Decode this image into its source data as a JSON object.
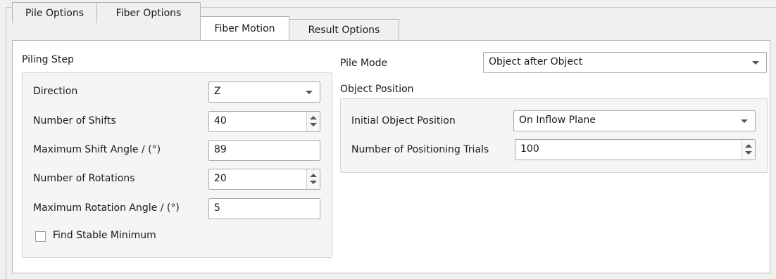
{
  "tabs": [
    {
      "label": "Pile Options"
    },
    {
      "label": "Fiber Options"
    },
    {
      "label": "Fiber Motion"
    },
    {
      "label": "Result Options"
    }
  ],
  "active_tab": "Fiber Motion",
  "piling_step": {
    "title": "Piling Step",
    "direction": {
      "label": "Direction",
      "value": "Z"
    },
    "shifts": {
      "label": "Number of Shifts",
      "value": "40"
    },
    "max_shift_angle": {
      "label": "Maximum Shift Angle / (°)",
      "value": "89"
    },
    "rotations": {
      "label": "Number of Rotations",
      "value": "20"
    },
    "max_rotation_angle": {
      "label": "Maximum Rotation Angle / (°)",
      "value": "5"
    },
    "find_stable_minimum": {
      "label": "Find Stable Minimum",
      "checked": false
    }
  },
  "pile_mode": {
    "label": "Pile Mode",
    "value": "Object after Object"
  },
  "object_position": {
    "title": "Object Position",
    "initial_position": {
      "label": "Initial Object Position",
      "value": "On Inflow Plane"
    },
    "positioning_trials": {
      "label": "Number of Positioning Trials",
      "value": "100"
    }
  }
}
